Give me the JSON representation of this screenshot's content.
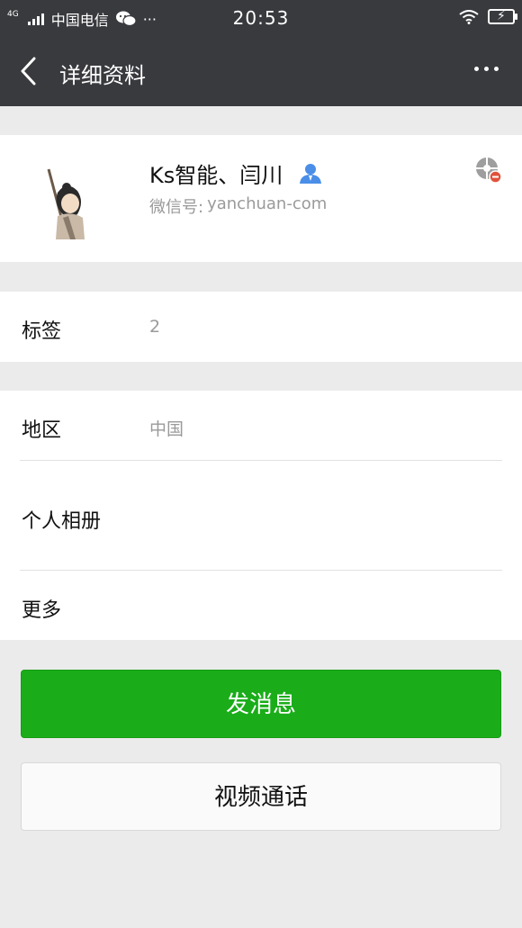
{
  "status_bar": {
    "network": "4G",
    "carrier": "中国电信",
    "more": "···",
    "time": "20:53"
  },
  "nav": {
    "title": "详细资料"
  },
  "profile": {
    "name": "Ks智能、闫川",
    "wechat_id_label": "微信号:",
    "wechat_id": "yanchuan-com"
  },
  "tags": {
    "label": "标签",
    "value": "2"
  },
  "info": {
    "region_label": "地区",
    "region_value": "中国",
    "album_label": "个人相册",
    "more_label": "更多"
  },
  "actions": {
    "send_message": "发消息",
    "video_call": "视频通话"
  },
  "colors": {
    "nav_bg": "#393a3e",
    "primary_green": "#1aad19",
    "page_bg": "#ebebeb",
    "secondary_text": "#9a9a9a",
    "contact_icon": "#4a8ee8",
    "star_badge": "#e0533b"
  },
  "icons": {
    "back": "chevron-left-icon",
    "more": "more-dots-icon",
    "contact": "contact-person-icon",
    "star": "star-friend-badge-icon"
  }
}
